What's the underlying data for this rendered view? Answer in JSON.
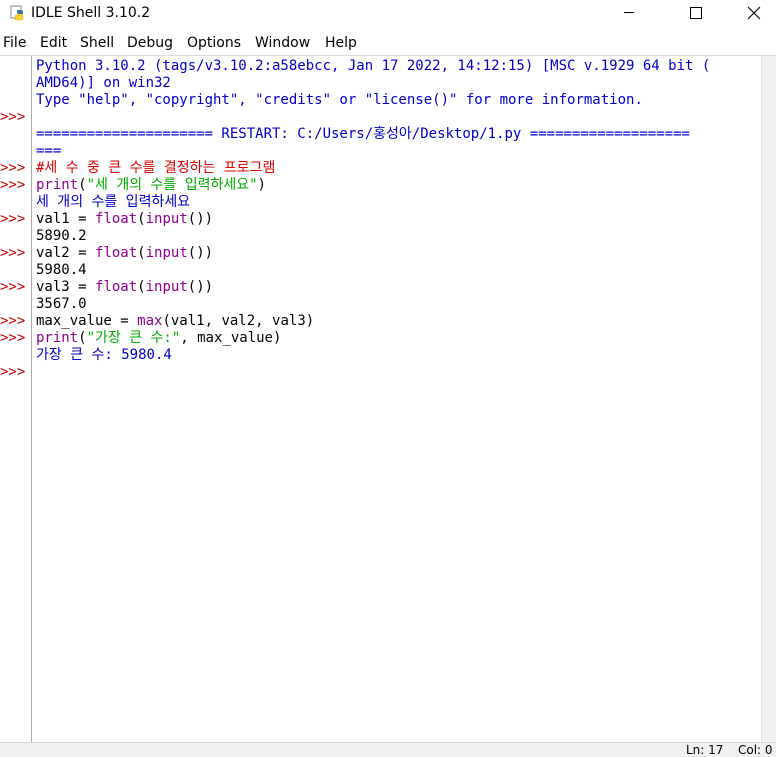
{
  "window": {
    "title": "IDLE Shell 3.10.2",
    "icon": "python-idle-icon",
    "controls": [
      "minimize-icon",
      "maximize-icon",
      "close-icon"
    ]
  },
  "menu": [
    "File",
    "Edit",
    "Shell",
    "Debug",
    "Options",
    "Window",
    "Help"
  ],
  "shell": {
    "banner": [
      "Python 3.10.2 (tags/v3.10.2:a58ebcc, Jan 17 2022, 14:12:15) [MSC v.1929 64 bit (",
      "AMD64)] on win32",
      "Type \"help\", \"copyright\", \"credits\" or \"license()\" for more information."
    ],
    "prompt": ">>>",
    "restart": {
      "line1": "===================== RESTART: C:/Users/홍성아/Desktop/1.py ===================",
      "line2": "==="
    },
    "comment_line": "#세 수 중 큰 수를 결정하는 프로그램",
    "print1": {
      "func": "print",
      "open": "(",
      "str": "\"세 개의 수를 입력하세요\"",
      "close": ")"
    },
    "output1": "세 개의 수를 입력하세요",
    "inputs": [
      {
        "var": "val1 = ",
        "float": "float",
        "paren1": "(",
        "input": "input",
        "paren2": "())",
        "value": "5890.2"
      },
      {
        "var": "val2 = ",
        "float": "float",
        "paren1": "(",
        "input": "input",
        "paren2": "())",
        "value": "5980.4"
      },
      {
        "var": "val3 = ",
        "float": "float",
        "paren1": "(",
        "input": "input",
        "paren2": "())",
        "value": "3567.0"
      }
    ],
    "max_line": {
      "lhs": "max_value = ",
      "func": "max",
      "args": "(val1, val2, val3)"
    },
    "print2": {
      "func": "print",
      "open": "(",
      "str": "\"가장 큰 수:\"",
      "rest": ", max_value)"
    },
    "output2": "가장 큰 수: 5980.4"
  },
  "status": {
    "line": "Ln: 17",
    "col": "Col: 0"
  },
  "colors": {
    "prompt": "#c00000",
    "stdout": "#0000cc",
    "comment": "#dd0000",
    "builtin": "#900090",
    "string": "#00aa00"
  }
}
